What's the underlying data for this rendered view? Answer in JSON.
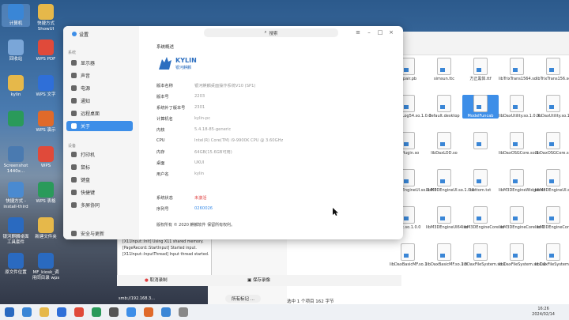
{
  "desktop": {
    "icons": [
      {
        "label": "计算机",
        "color": "#3a86d6"
      },
      {
        "label": "快捷方式\nShowUI",
        "color": "#e6b84a"
      },
      {
        "label": "回收站",
        "color": "#7aa6d8"
      },
      {
        "label": "WPS PDF",
        "color": "#e04a3a"
      },
      {
        "label": "kylin",
        "color": "#e6b84a"
      },
      {
        "label": "WPS 文字",
        "color": "#2f6fd8"
      },
      {
        "label": "",
        "color": "#2a9a5a"
      },
      {
        "label": "WPS 演示",
        "color": "#e06a2a"
      },
      {
        "label": "Screenshot\n1440x...",
        "color": "#4a7ab0"
      },
      {
        "label": "WPS",
        "color": "#e04a3a"
      },
      {
        "label": "快捷方式 - install-third",
        "color": "#4a8ad0"
      },
      {
        "label": "WPS 表格",
        "color": "#2a9a5a"
      },
      {
        "label": "银河麒麟桌面工具套件",
        "color": "#2a6ac0"
      },
      {
        "label": "新建文件夹",
        "color": "#e6b84a"
      },
      {
        "label": "原文件位置",
        "color": "#2a6ac0"
      },
      {
        "label": "MF_kiosk_调用同目录 wps",
        "color": "#2a6ac0"
      }
    ]
  },
  "fileManager": {
    "files": [
      [
        "repair.pb",
        "simsun.ttc",
        "方正黑体.ttf",
        "libTrixTrans1564.so",
        "libTrixTrans156.so"
      ],
      [
        "libQtQLog54.so.1.0.0",
        "default.desktop",
        "ModelFuncab",
        "libDaxUtility.so.1.0.0",
        "libDaxUtility.so.1"
      ],
      [
        "libPlugin.so",
        "libDaxLOD.so",
        "",
        "libDaxOSGCore.so.1",
        "libDaxOSGCore.so.1.0"
      ],
      [
        "libDaxEngineUI.so.1.0.0",
        "libM3DEngineUI.so.1.0.0",
        "bottom.txt",
        "libM3DEngineWidget.so",
        "libM3DEngineUI.so"
      ],
      [
        "dget.so.1.0.0",
        "libM3DEngineUI64.so",
        "libM3DEngineCore.so",
        "libM3DEngineCore.so.1",
        "libM3DEngineCore.so.1.0.0"
      ],
      [
        "libDaxBasicMF.so.1",
        "libDaxBasicMF.so.1.0",
        "libDaxFileSystem.so.1",
        "libDaxFileSystem.so.1.0",
        "libDaxFileSystem.so.1.0.0"
      ]
    ],
    "status": "选中 1 个项目   162 字节",
    "bottom_button": "所有标记 ..."
  },
  "logs": {
    "lines": [
      "[PageRecord::StartInput] Starting input ...",
      "[X11Input::Init] Using X11 shared memory.",
      "[PageRecord::StartInput] Started input.",
      "[X11Input::InputThread] Input thread started."
    ],
    "stop_label": "取消录制",
    "save_label": "保存录像",
    "path": "smb://192.168.3..."
  },
  "settings": {
    "title": "设置",
    "search": "搜索",
    "sections": [
      "系统",
      "设备"
    ],
    "items_system": [
      "显示器",
      "声音",
      "电源",
      "通知",
      "远程桌面",
      "关于"
    ],
    "items_device": [
      "打印机",
      "鼠标",
      "键盘",
      "快捷键",
      "多屏协同"
    ],
    "item_update": "安全与更新",
    "page_title": "系统概述",
    "rows": [
      {
        "k": "版本名称",
        "v": "银河麒麟桌面操作系统V10 (SP1)"
      },
      {
        "k": "版本号",
        "v": "2203"
      },
      {
        "k": "系统补丁版本号",
        "v": "2301"
      },
      {
        "k": "计算机名",
        "v": "kylin-pc"
      },
      {
        "k": "内核",
        "v": "5.4.18-85-generic"
      },
      {
        "k": "CPU",
        "v": "Intel(R) Core(TM) i9-9900K CPU @ 3.60GHz"
      },
      {
        "k": "内存",
        "v": "64GB(15.6GB可用)"
      },
      {
        "k": "桌面",
        "v": "UKUI"
      },
      {
        "k": "用户名",
        "v": "kylin"
      }
    ],
    "status_label": "系统状态",
    "status_value": "未激活",
    "serial_label": "序列号",
    "serial_value": "0260026",
    "activate_label": "激活",
    "copyright": "版权所有 © 2020 麒麟软件 保留所有权利。",
    "logo_text": "KYLIN",
    "logo_sub": "银河麒麟"
  },
  "taskbar": {
    "time": "16:26",
    "date": "2024/02/14"
  },
  "colors": {
    "accent": "#3d8ee8",
    "warn": "#e04040",
    "link": "#3d8ee8"
  }
}
